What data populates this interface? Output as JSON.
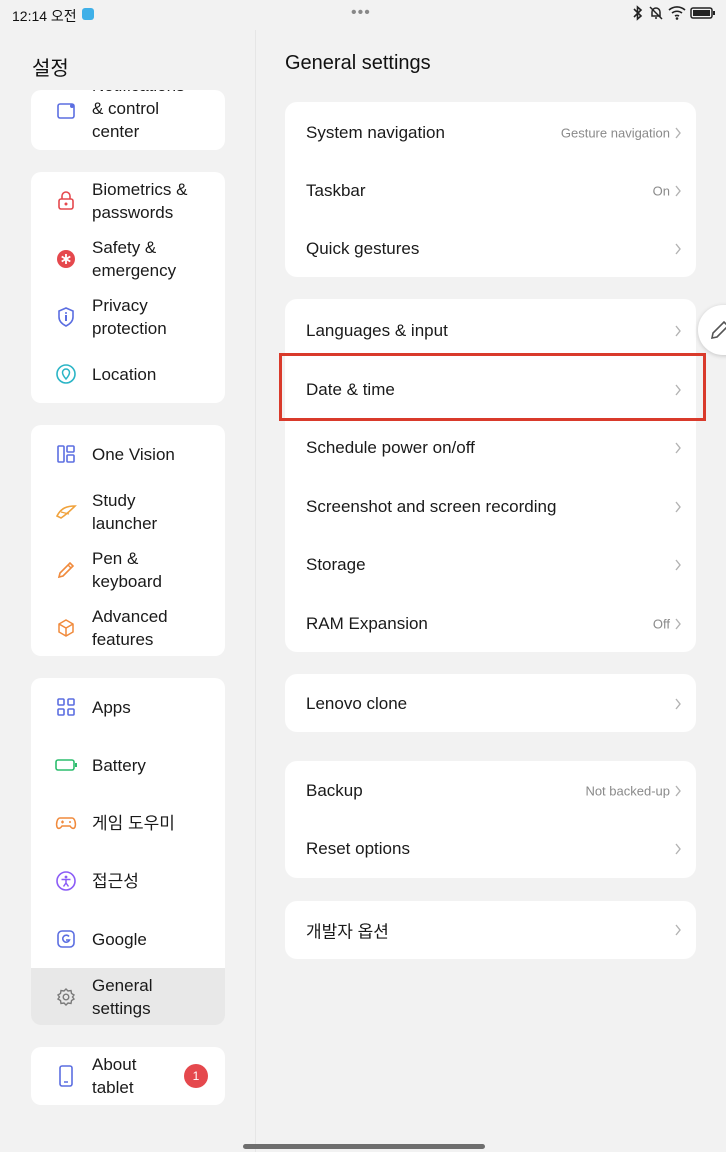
{
  "status": {
    "time": "12:14 오전",
    "dots": "•••"
  },
  "sidebar": {
    "title": "설정",
    "groups": [
      {
        "items": [
          {
            "label": "Notifications\n& control\ncenter",
            "icon": "notification-icon"
          }
        ]
      },
      {
        "items": [
          {
            "label": "Biometrics &\npasswords",
            "icon": "lock-icon"
          },
          {
            "label": "Safety &\nemergency",
            "icon": "asterisk-icon"
          },
          {
            "label": "Privacy\nprotection",
            "icon": "shield-icon"
          },
          {
            "label": "Location",
            "icon": "location-icon"
          }
        ]
      },
      {
        "items": [
          {
            "label": "One Vision",
            "icon": "one-vision-icon"
          },
          {
            "label": "Study\nlauncher",
            "icon": "study-icon"
          },
          {
            "label": "Pen &\nkeyboard",
            "icon": "pen-icon"
          },
          {
            "label": "Advanced\nfeatures",
            "icon": "cube-icon"
          }
        ]
      },
      {
        "items": [
          {
            "label": "Apps",
            "icon": "apps-icon"
          },
          {
            "label": "Battery",
            "icon": "battery-icon"
          },
          {
            "label": "게임 도우미",
            "icon": "gamepad-icon"
          },
          {
            "label": "접근성",
            "icon": "accessibility-icon"
          },
          {
            "label": "Google",
            "icon": "google-icon"
          },
          {
            "label": "General\nsettings",
            "icon": "gear-icon",
            "active": true
          }
        ]
      },
      {
        "items": [
          {
            "label": "About\ntablet",
            "icon": "tablet-icon",
            "badge": "1"
          }
        ]
      }
    ]
  },
  "main": {
    "title": "General settings",
    "sections": [
      {
        "rows": [
          {
            "label": "System navigation",
            "value": "Gesture navigation"
          },
          {
            "label": "Taskbar",
            "value": "On"
          },
          {
            "label": "Quick gestures",
            "value": ""
          }
        ]
      },
      {
        "rows": [
          {
            "label": "Languages & input",
            "value": ""
          },
          {
            "label": "Date & time",
            "value": ""
          },
          {
            "label": "Schedule power on/off",
            "value": ""
          },
          {
            "label": "Screenshot and screen recording",
            "value": ""
          },
          {
            "label": "Storage",
            "value": ""
          },
          {
            "label": "RAM Expansion",
            "value": "Off"
          }
        ]
      },
      {
        "rows": [
          {
            "label": "Lenovo clone",
            "value": ""
          }
        ]
      },
      {
        "rows": [
          {
            "label": "Backup",
            "value": "Not backed-up"
          },
          {
            "label": "Reset options",
            "value": ""
          }
        ]
      },
      {
        "rows": [
          {
            "label": "개발자 옵션",
            "value": ""
          }
        ]
      }
    ]
  },
  "colors": {
    "accent_blue": "#5b6ee1",
    "highlight_red": "#d93a2b",
    "badge_red": "#e5484d",
    "lock_red": "#e5484d",
    "green": "#2dbd6e",
    "orange": "#f08a3c",
    "purple": "#8b5cf6",
    "teal": "#2bb5c6"
  }
}
